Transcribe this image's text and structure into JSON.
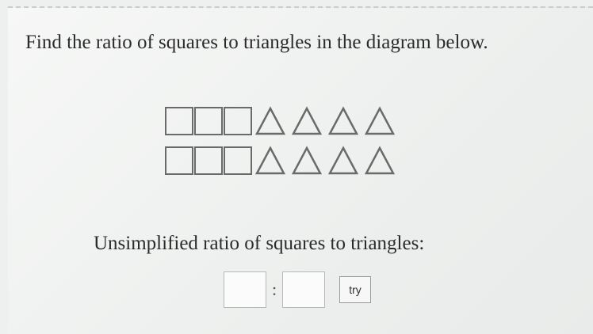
{
  "question": {
    "text": "Find the ratio of squares to triangles in the diagram below."
  },
  "diagram": {
    "rows": [
      {
        "squares": 3,
        "triangles": 4
      },
      {
        "squares": 3,
        "triangles": 4
      }
    ],
    "icons": [
      "square-icon",
      "triangle-icon"
    ]
  },
  "prompt": {
    "text": "Unsimplified ratio of squares to triangles:"
  },
  "answer": {
    "left_value": "",
    "separator": ":",
    "right_value": "",
    "try_label": "try"
  },
  "colors": {
    "shape_stroke": "#6a6a6a",
    "text": "#2b2b2b"
  }
}
